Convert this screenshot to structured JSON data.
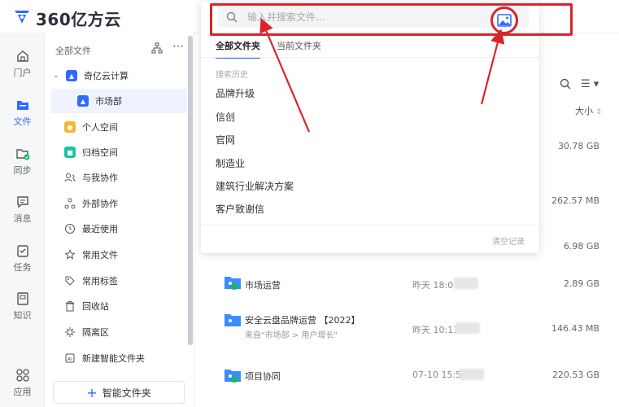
{
  "app": {
    "logo_text": "360亿方云"
  },
  "rail": [
    {
      "label": "门户",
      "icon": "home-icon"
    },
    {
      "label": "文件",
      "icon": "file-folder-icon",
      "active": true
    },
    {
      "label": "同步",
      "icon": "sync-folder-icon"
    },
    {
      "label": "消息",
      "icon": "message-icon"
    },
    {
      "label": "任务",
      "icon": "task-icon"
    },
    {
      "label": "知识",
      "icon": "knowledge-icon"
    },
    {
      "label": "应用",
      "icon": "apps-icon"
    }
  ],
  "sidebar": {
    "header": "全部文件",
    "items": [
      {
        "label": "奇亿云计算"
      },
      {
        "label": "市场部"
      },
      {
        "label": "个人空间"
      },
      {
        "label": "归档空间"
      },
      {
        "label": "与我协作"
      },
      {
        "label": "外部协作"
      },
      {
        "label": "最近使用"
      },
      {
        "label": "常用文件"
      },
      {
        "label": "常用标签"
      },
      {
        "label": "回收站"
      },
      {
        "label": "隔离区"
      },
      {
        "label": "新建智能文件夹"
      }
    ],
    "new_button": "智能文件夹"
  },
  "search": {
    "placeholder": "输入并搜索文件...",
    "tabs": [
      "全部文件夹",
      "当前文件夹"
    ],
    "history_title": "搜索历史",
    "history": [
      "品牌升级",
      "信创",
      "官网",
      "制造业",
      "建筑行业解决方案",
      "客户致谢信"
    ],
    "clear_label": "清空记录"
  },
  "list": {
    "size_header": "大小",
    "sizes_above": [
      "30.78 GB",
      "262.57 MB",
      "6.98 GB"
    ],
    "rows": [
      {
        "name": "市场运营",
        "sub": "",
        "time": "昨天 18:0",
        "size": "2.89 GB"
      },
      {
        "name": "安全云盘品牌运营 【2022】",
        "sub": "来自\"市场部 > 用户增长\"",
        "time": "昨天 10:13",
        "size": "146.43 MB"
      },
      {
        "name": "项目协同",
        "sub": "",
        "time": "07-10 15:57",
        "size": "220.53 GB"
      }
    ]
  },
  "colors": {
    "accent": "#2f6bff",
    "annotation_red": "#d9242a"
  }
}
